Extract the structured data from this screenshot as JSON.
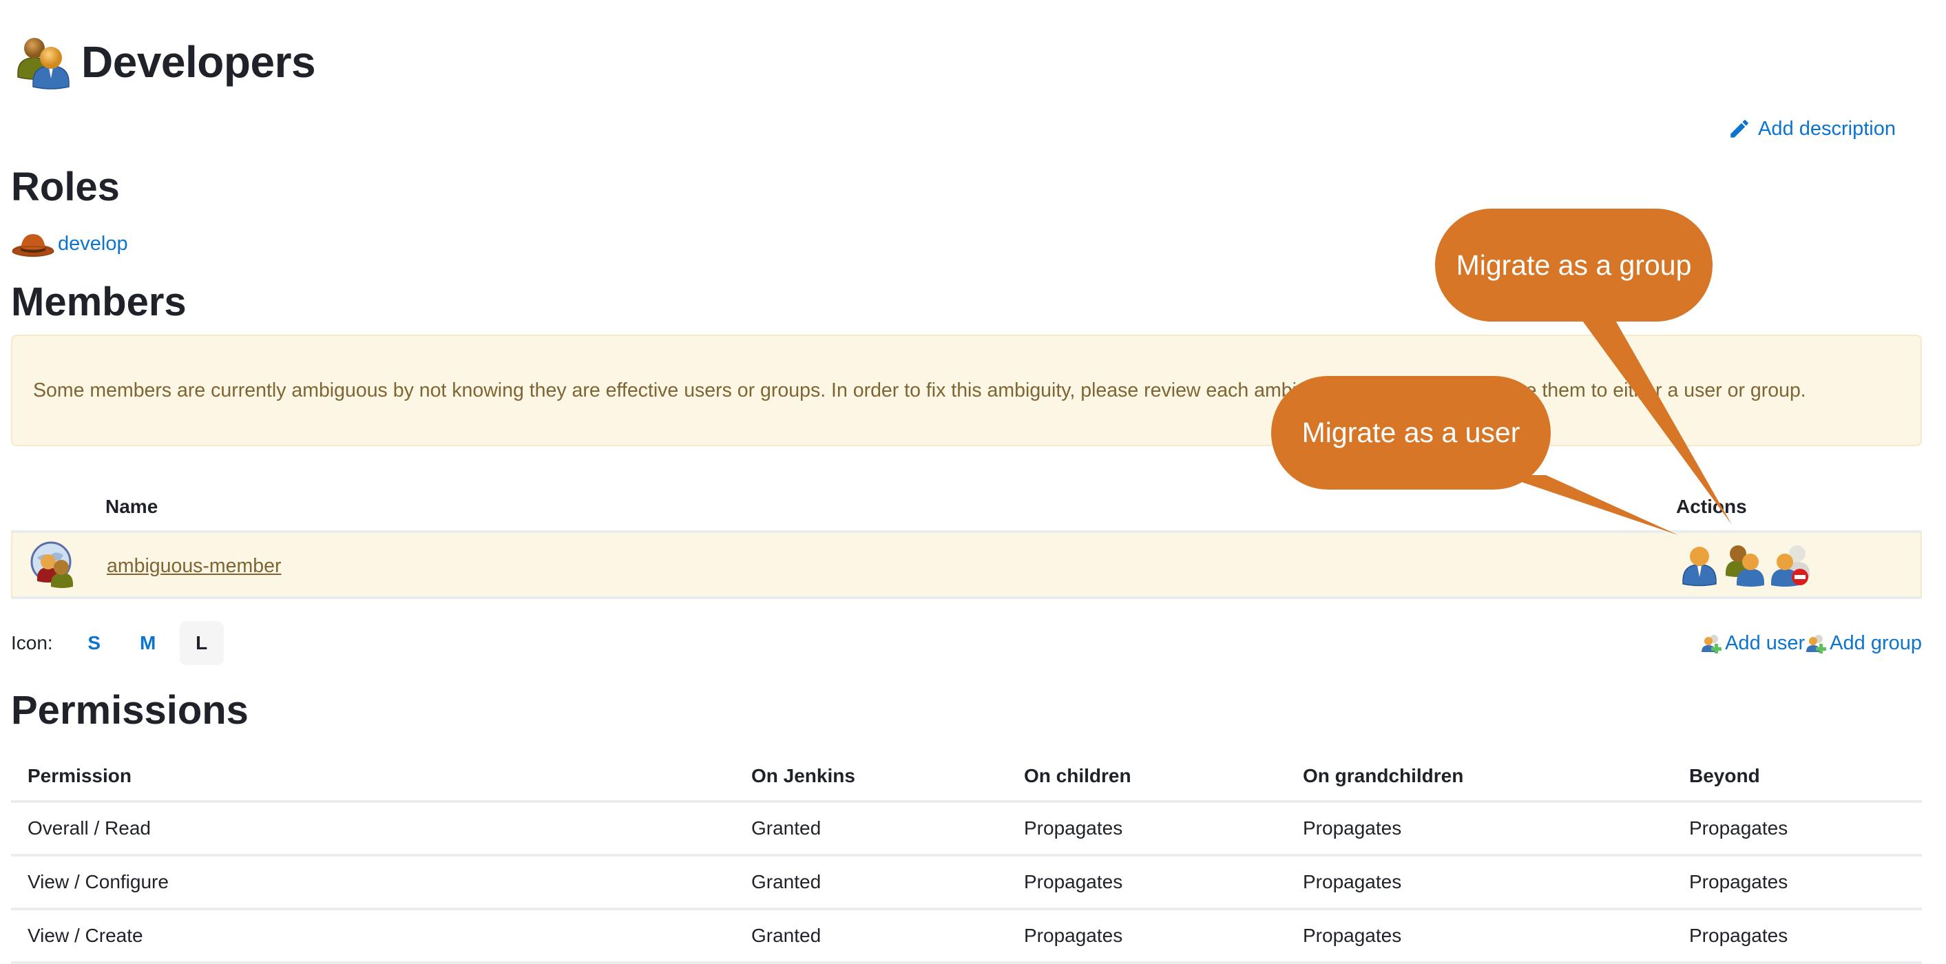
{
  "header": {
    "title": "Developers",
    "title_icon": "group-icon",
    "add_description_label": "Add description"
  },
  "roles": {
    "heading": "Roles",
    "items": [
      {
        "label": "develop",
        "icon": "fedora-hat-icon"
      }
    ]
  },
  "members": {
    "heading": "Members",
    "warning": "Some members are currently ambiguous by not knowing they are effective users or groups. In order to fix this ambiguity, please review each ambiguous member and migrate them to either a user or group.",
    "columns": {
      "icon": "",
      "name": "Name",
      "actions": "Actions"
    },
    "rows": [
      {
        "icon": "ambiguous-member-icon",
        "name": "ambiguous-member",
        "actions": [
          {
            "name": "migrate-as-user",
            "icon": "user-icon"
          },
          {
            "name": "migrate-as-group",
            "icon": "group-icon"
          },
          {
            "name": "remove-member",
            "icon": "remove-user-icon"
          }
        ]
      }
    ],
    "icon_size": {
      "label": "Icon:",
      "options": [
        "S",
        "M",
        "L"
      ],
      "selected": "L"
    },
    "add_user_label": "Add user",
    "add_group_label": "Add group"
  },
  "callouts": {
    "group": "Migrate as a group",
    "user": "Migrate as a user",
    "color": "#d67626"
  },
  "permissions": {
    "heading": "Permissions",
    "columns": [
      "Permission",
      "On Jenkins",
      "On children",
      "On grandchildren",
      "Beyond"
    ],
    "rows": [
      [
        "Overall / Read",
        "Granted",
        "Propagates",
        "Propagates",
        "Propagates"
      ],
      [
        "View / Configure",
        "Granted",
        "Propagates",
        "Propagates",
        "Propagates"
      ],
      [
        "View / Create",
        "Granted",
        "Propagates",
        "Propagates",
        "Propagates"
      ]
    ]
  },
  "colors": {
    "link": "#0b74d0",
    "warning_bg": "#fbf7e4",
    "warning_text": "#7f6534",
    "heading": "#1f2329"
  }
}
